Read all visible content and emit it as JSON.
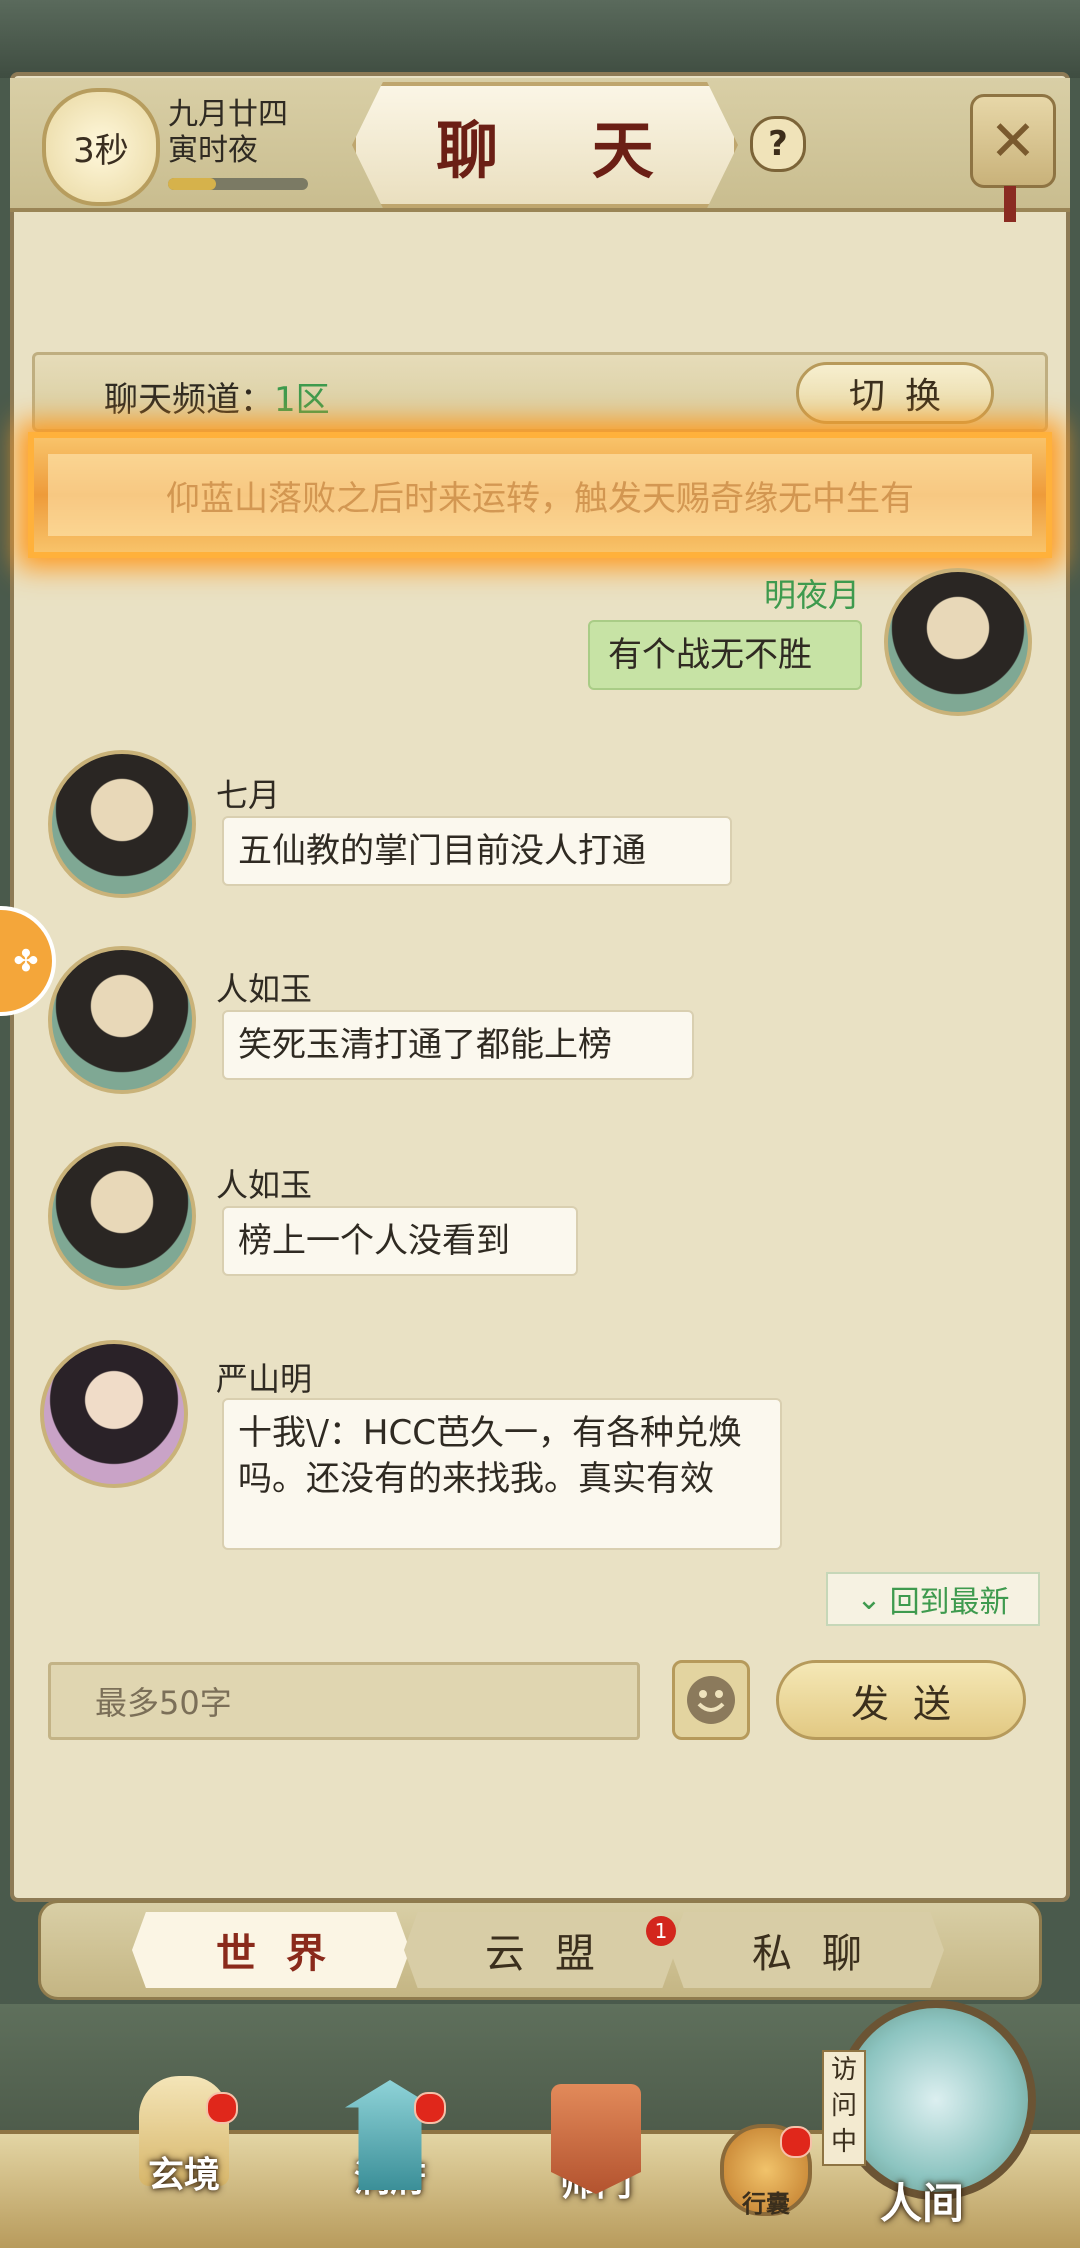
{
  "header": {
    "timer": "3秒",
    "date_line1": "九月廿四",
    "date_line2": "寅时夜",
    "title": "聊 天",
    "help_icon": "question-icon",
    "close_icon": "close-x-icon"
  },
  "channel": {
    "label": "聊天频道：",
    "value": "1区",
    "switch_label": "切换"
  },
  "announcement": {
    "text": "仰蓝山落败之后时来运转，触发天赐奇缘无中生有"
  },
  "messages": [
    {
      "sender": "明夜月",
      "text": "有个战无不胜",
      "self": true
    },
    {
      "sender": "七月",
      "text": "五仙教的掌门目前没人打通",
      "self": false
    },
    {
      "sender": "人如玉",
      "text": "笑死玉清打通了都能上榜",
      "self": false
    },
    {
      "sender": "人如玉",
      "text": "榜上一个人没看到",
      "self": false
    },
    {
      "sender": "严山明",
      "text": "十我\\/：HCC芭久一，有各种兑焕吗。还没有的来找我。真实有效",
      "self": false
    }
  ],
  "scroll_latest_label": "回到最新",
  "input": {
    "placeholder": "最多50字",
    "send_label": "发送",
    "emoji_icon": "smiley-icon"
  },
  "tabs": [
    {
      "label": "世界",
      "active": true
    },
    {
      "label": "云盟",
      "badge": "1"
    },
    {
      "label": "私聊"
    }
  ],
  "bottom_nav": [
    {
      "label": "玄境",
      "dot": true
    },
    {
      "label": "洞府",
      "dot": true
    },
    {
      "label": "师门",
      "dot": false
    },
    {
      "label": "行囊",
      "dot": true
    },
    {
      "label": "人间",
      "dot": false
    }
  ],
  "visiting_label": "访问中",
  "colors": {
    "accent_green": "#3e9a4e",
    "title_red": "#6b1f15",
    "badge_red": "#d3261d"
  }
}
